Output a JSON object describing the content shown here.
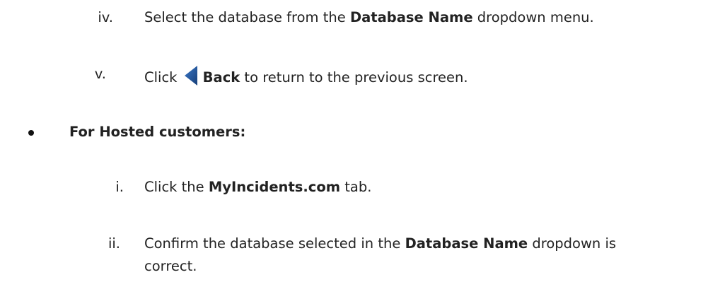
{
  "items": {
    "iv": {
      "numeral": "iv.",
      "t1": "Select the database from the ",
      "b1": "Database Name",
      "t2": " dropdown menu."
    },
    "v": {
      "numeral": "v.",
      "t1": "Click",
      "icon": "back-triangle-icon",
      "b1": "Back",
      "t2": " to return to the previous screen."
    },
    "hosted": {
      "label": "For Hosted customers:"
    },
    "i": {
      "numeral": "i.",
      "t1": "Click the ",
      "b1": "MyIncidents.com",
      "t2": " tab."
    },
    "ii": {
      "numeral": "ii.",
      "t1": "Confirm the database selected in the ",
      "b1": "Database Name",
      "t2": " dropdown is",
      "t3": "correct."
    }
  },
  "colors": {
    "text": "#222222",
    "icon": "#1f4f8f"
  }
}
